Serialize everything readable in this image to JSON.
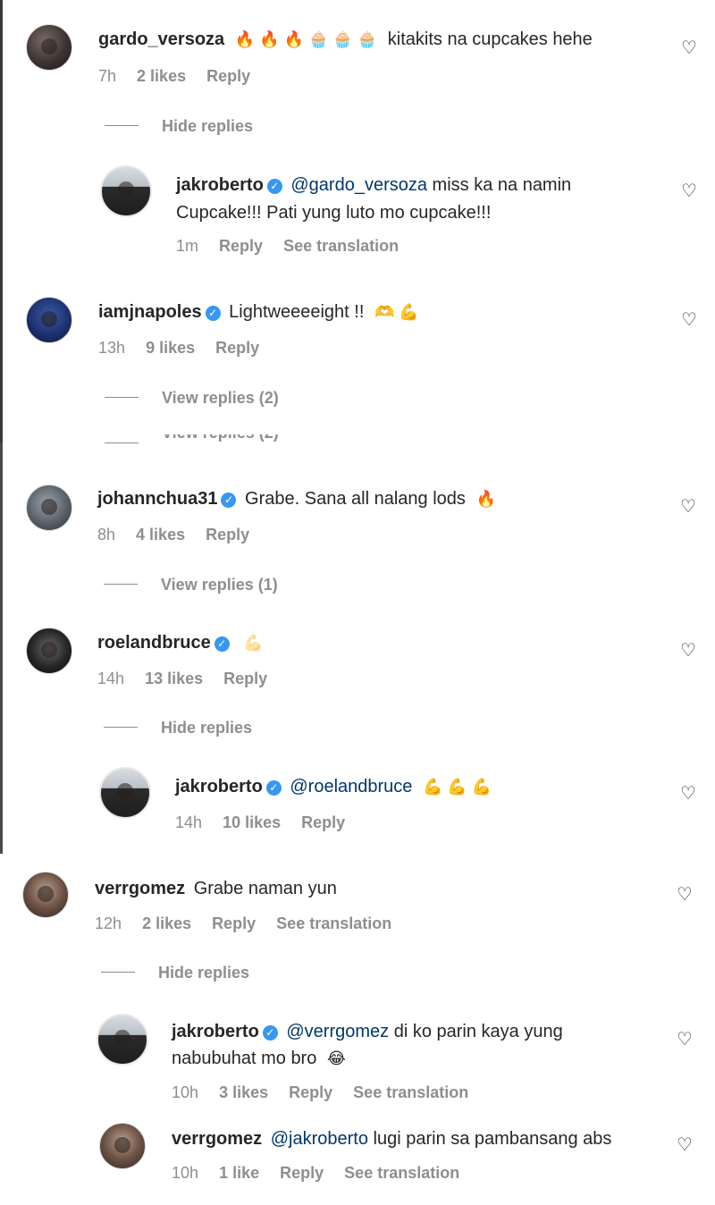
{
  "colors": {
    "text": "#262626",
    "muted": "#8e8e8e",
    "mention": "#00376b",
    "verified": "#3897f0"
  },
  "comments": [
    {
      "username": "gardo_versoza",
      "emojis": "🔥 🔥 🔥 🧁 🧁 🧁",
      "text": "kitakits na cupcakes hehe",
      "time": "7h",
      "likes": "2 likes",
      "reply": "Reply",
      "toggle": "Hide replies",
      "replies": [
        {
          "username": "jakroberto",
          "mention": "@gardo_versoza",
          "text": "miss ka na namin",
          "text2": "Cupcake!!! Pati yung luto mo cupcake!!!",
          "time": "1m",
          "reply": "Reply",
          "translation": "See translation"
        }
      ]
    },
    {
      "username": "iamjnapoles",
      "text": "Lightweeeeight !!",
      "emojis": "🫶 💪",
      "time": "13h",
      "likes": "9 likes",
      "reply": "Reply",
      "toggle": "View replies (2)"
    },
    {
      "username": "johannchua31",
      "text": "Grabe. Sana all nalang lods",
      "emojis": "🔥",
      "time": "8h",
      "likes": "4 likes",
      "reply": "Reply",
      "toggle": "View replies (1)"
    },
    {
      "username": "roelandbruce",
      "emojis": "💪",
      "time": "14h",
      "likes": "13 likes",
      "reply": "Reply",
      "toggle": "Hide replies",
      "replies": [
        {
          "username": "jakroberto",
          "mention": "@roelandbruce",
          "emojis": "💪 💪 💪",
          "time": "14h",
          "likes": "10 likes",
          "reply": "Reply"
        }
      ]
    },
    {
      "username": "verrgomez",
      "text": "Grabe naman yun",
      "time": "12h",
      "likes": "2 likes",
      "reply": "Reply",
      "translation": "See translation",
      "toggle": "Hide replies",
      "replies": [
        {
          "username": "jakroberto",
          "mention": "@verrgomez",
          "text": "di ko parin kaya yung",
          "text2": "nabubuhat mo bro",
          "emojis": "😂",
          "time": "10h",
          "likes": "3 likes",
          "reply": "Reply",
          "translation": "See translation"
        },
        {
          "username": "verrgomez",
          "mention": "@jakroberto",
          "text": "lugi parin sa pambansang abs",
          "time": "10h",
          "likes": "1 like",
          "reply": "Reply",
          "translation": "See translation"
        }
      ]
    }
  ],
  "icons": {
    "heart": "heart-outline-icon",
    "verified": "verified-badge-icon"
  }
}
